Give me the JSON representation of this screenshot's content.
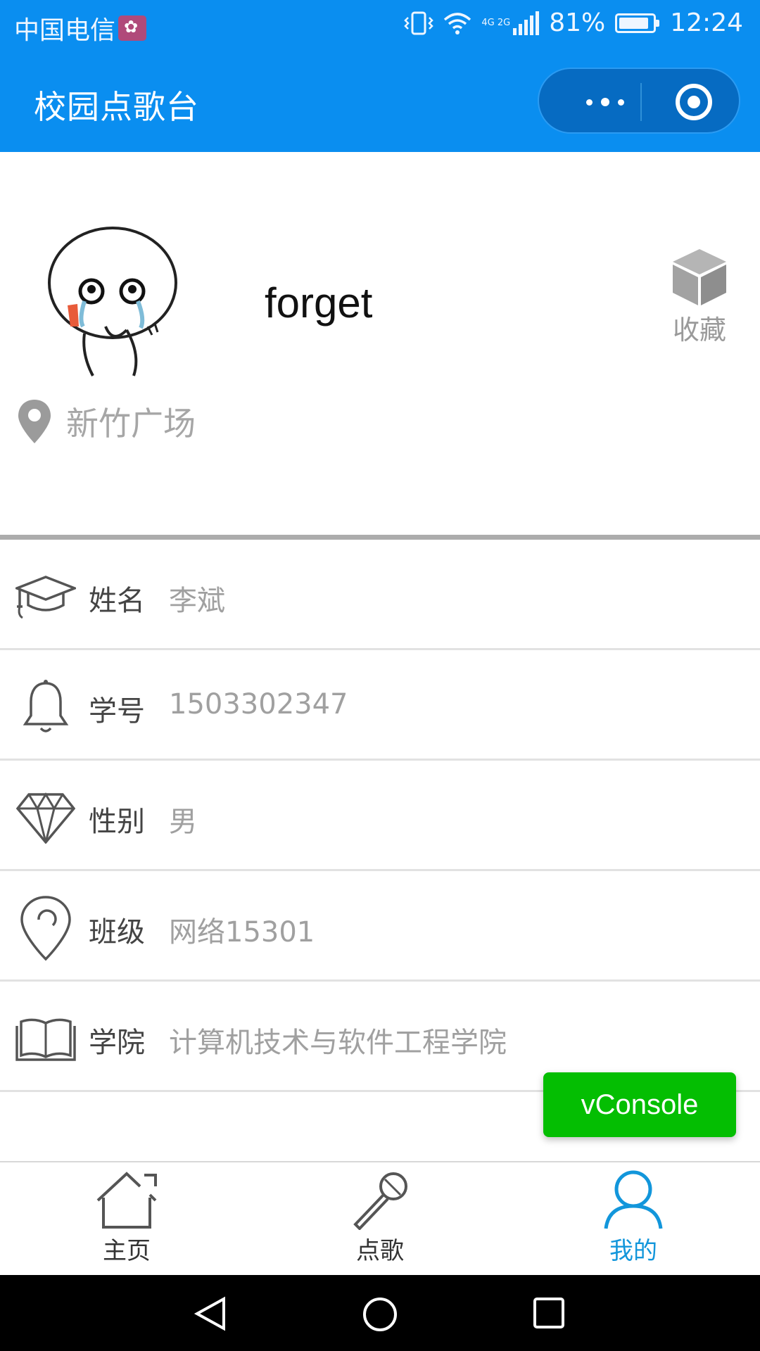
{
  "status_bar": {
    "carrier": "中国电信",
    "network": "4G 2G",
    "battery": "81%",
    "time": "12:24",
    "icons": [
      "vibrate-icon",
      "wifi-icon",
      "signal-icon",
      "battery-icon"
    ]
  },
  "navbar": {
    "title": "校园点歌台",
    "background": "#0a8ef0",
    "capsule_icons": [
      "more-icon",
      "close-miniprogram-icon"
    ]
  },
  "profile": {
    "username": "forget",
    "favorites_label": "收藏",
    "favorites_icon": "cube-icon",
    "location": "新竹广场",
    "location_icon": "location-pin-icon",
    "avatar_icon": "crying-cartoon-avatar"
  },
  "info": [
    {
      "label": "姓名",
      "value": "李斌",
      "icon": "graduation-cap-icon"
    },
    {
      "label": "学号",
      "value": "1503302347",
      "icon": "bell-icon"
    },
    {
      "label": "性别",
      "value": "男",
      "icon": "diamond-icon"
    },
    {
      "label": "班级",
      "value": "网络15301",
      "icon": "map-pin-outline-icon"
    },
    {
      "label": "学院",
      "value": "计算机技术与软件工程学院",
      "icon": "book-icon"
    }
  ],
  "vconsole": {
    "label": "vConsole",
    "color": "#04be02"
  },
  "tabbar": {
    "active_color": "#1296db",
    "tabs": [
      {
        "label": "主页",
        "icon": "home-icon",
        "active": false
      },
      {
        "label": "点歌",
        "icon": "microphone-icon",
        "active": false
      },
      {
        "label": "我的",
        "icon": "user-icon",
        "active": true
      }
    ]
  },
  "system_nav": {
    "icons": [
      "back-icon",
      "home-circle-icon",
      "recents-icon"
    ]
  }
}
